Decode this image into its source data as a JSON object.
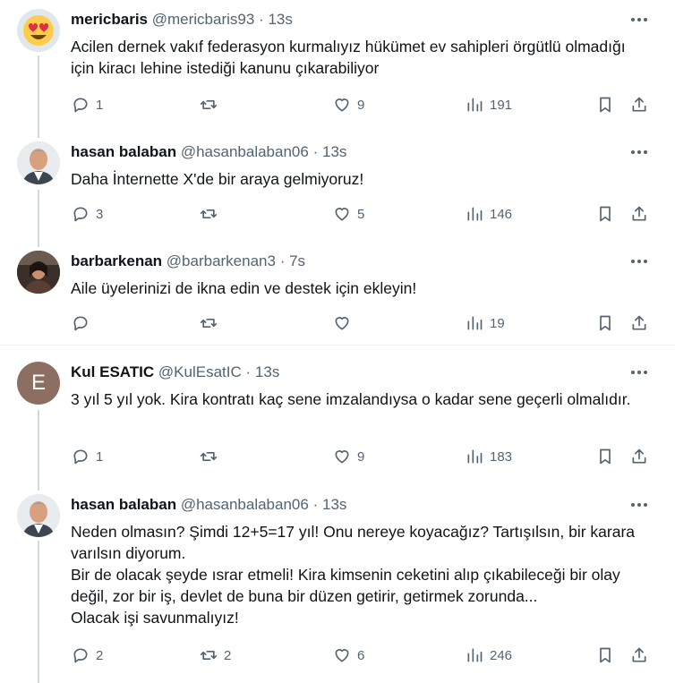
{
  "tweets": [
    {
      "name": "mericbaris",
      "handle": "@mericbaris93",
      "time": "13s",
      "text": "Acilen dernek vakıf federasyon kurmalıyız hükümet ev sahipleri örgütlü olmadığı için kiracı lehine istediği kanunu çıkarabiliyor",
      "avatar": "heart-eyes-emoji",
      "replies": "1",
      "retweets": "",
      "likes": "9",
      "views": "191"
    },
    {
      "name": "hasan balaban",
      "handle": "@hasanbalaban06",
      "time": "13s",
      "text": "Daha İnternette X'de bir araya gelmiyoruz!",
      "avatar": "photo",
      "replies": "3",
      "retweets": "",
      "likes": "5",
      "views": "146"
    },
    {
      "name": "barbarkenan",
      "handle": "@barbarkenan3",
      "time": "7s",
      "text": "Aile üyelerinizi de ikna edin ve destek için ekleyin!",
      "avatar": "photo",
      "replies": "",
      "retweets": "",
      "likes": "",
      "views": "19"
    },
    {
      "name": "Kul ESATIC",
      "handle": "@KulEsatIC",
      "time": "13s",
      "text": "3 yıl 5 yıl yok. Kira kontratı kaç sene imzalandıysa o kadar sene geçerli olmalıdır.",
      "avatar_letter": "E",
      "avatar_color": "#8d6e63",
      "replies": "1",
      "retweets": "",
      "likes": "9",
      "views": "183"
    },
    {
      "name": "hasan balaban",
      "handle": "@hasanbalaban06",
      "time": "13s",
      "text": "Neden olmasın? Şimdi 12+5=17 yıl! Onu nereye koyacağız? Tartışılsın, bir karara varılsın diyorum.\nBir de olacak şeyde ısrar etmeli! Kira kimsenin ceketini alıp çıkabileceği bir olay değil, zor bir iş, devlet de buna bir düzen getirir, getirmek zorunda...\nOlacak işi savunmalıyız!",
      "avatar": "photo",
      "replies": "2",
      "retweets": "2",
      "likes": "6",
      "views": "246"
    }
  ],
  "dot": "·",
  "colors": {
    "text": "#0f1419",
    "secondary": "#536471",
    "thread_line": "#cfd9de"
  }
}
